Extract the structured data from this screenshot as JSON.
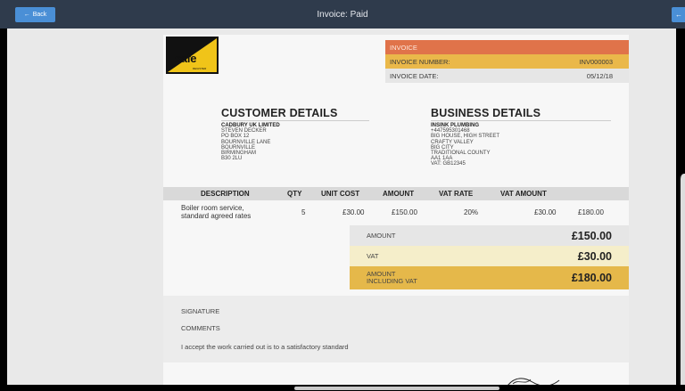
{
  "topbar": {
    "back_label": "Back",
    "title": "Invoice: Paid"
  },
  "logo": {
    "text": "safe",
    "small": "REGISTER"
  },
  "invoice_box": {
    "heading": "INVOICE",
    "number_label": "INVOICE NUMBER:",
    "number_value": "INV000003",
    "date_label": "INVOICE DATE:",
    "date_value": "05/12/18"
  },
  "customer": {
    "heading": "CUSTOMER DETAILS",
    "name": "CADBURY UK LIMITED",
    "lines": [
      "STEVEN DECKER",
      "PO BOX 12",
      "BOURNVILLE LANE",
      "BOURNVILLE",
      "BIRMINGHAM",
      "B30 2LU"
    ]
  },
  "business": {
    "heading": "BUSINESS DETAILS",
    "name": "INSINK PLUMBING",
    "lines": [
      "+447595301468",
      "BIG HOUSE, HIGH STREET",
      "CRAFTY VALLEY",
      "BIG CITY",
      "TRADITIONAL COUNTY",
      "AA1 1AA",
      "VAT: GB12345"
    ]
  },
  "table": {
    "headers": [
      "DESCRIPTION",
      "QTY",
      "UNIT COST",
      "AMOUNT",
      "VAT RATE",
      "VAT AMOUNT"
    ],
    "row": {
      "description_line1": "Boiler room service,",
      "description_line2": "standard agreed rates",
      "qty": "5",
      "unit_cost": "£30.00",
      "amount": "£150.00",
      "vat_rate": "20%",
      "vat_amount": "£30.00",
      "total": "£180.00"
    }
  },
  "totals": {
    "amount_label": "AMOUNT",
    "amount_value": "£150.00",
    "vat_label": "VAT",
    "vat_value": "£30.00",
    "total_label_line1": "AMOUNT",
    "total_label_line2": "INCLUDING VAT",
    "total_value": "£180.00"
  },
  "signature": {
    "signature_label": "SIGNATURE",
    "comments_label": "COMMENTS",
    "comment_text": "I accept the work carried out is to a satisfactory standard"
  },
  "colors": {
    "topbar": "#2f3b4c",
    "button": "#4a8fd6",
    "invoice_orange": "#e0734a",
    "invoice_yellow": "#eab84a",
    "total_gold": "#e5b84a"
  }
}
